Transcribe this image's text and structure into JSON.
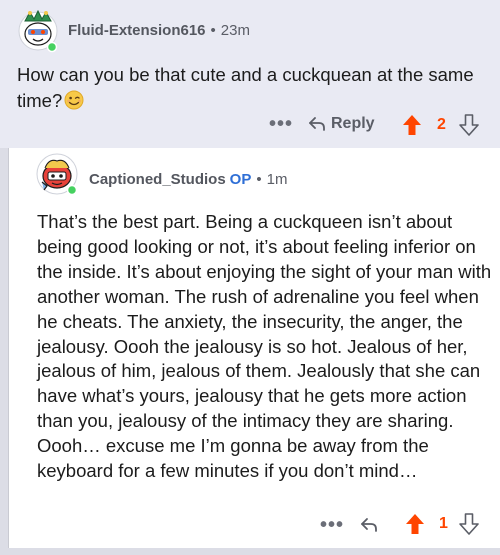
{
  "parent": {
    "author": "Fluid-Extension616",
    "separator": "•",
    "time": "23m",
    "body": "How can you be that cute and a cuckquean at the same time?",
    "emoji": "winking-face",
    "more": "•••",
    "reply_label": "Reply",
    "score": "2"
  },
  "reply": {
    "author": "Captioned_Studios",
    "op_badge": "OP",
    "separator": "•",
    "time": "1m",
    "body": "That’s the best part. Being a cuckqueen isn’t about being good looking or not, it’s about feeling inferior on the inside. It’s about enjoying the sight of your man with another woman. The rush of adrenaline you feel when he cheats. The anxiety, the insecurity, the anger, the jealousy. Oooh the jealousy is so hot. Jealous of her, jealous of him, jealous of them. Jealously that she can have what’s yours, jealousy that he gets more action than you, jealousy of the intimacy they are sharing. Oooh… excuse me I’m gonna be away from the keyboard for a few minutes if you don’t mind…",
    "more": "•••",
    "score": "1"
  },
  "colors": {
    "upvote": "#ff4500",
    "op": "#2f6fd6",
    "online": "#46d160",
    "parent_bg": "#e9eaf3"
  }
}
